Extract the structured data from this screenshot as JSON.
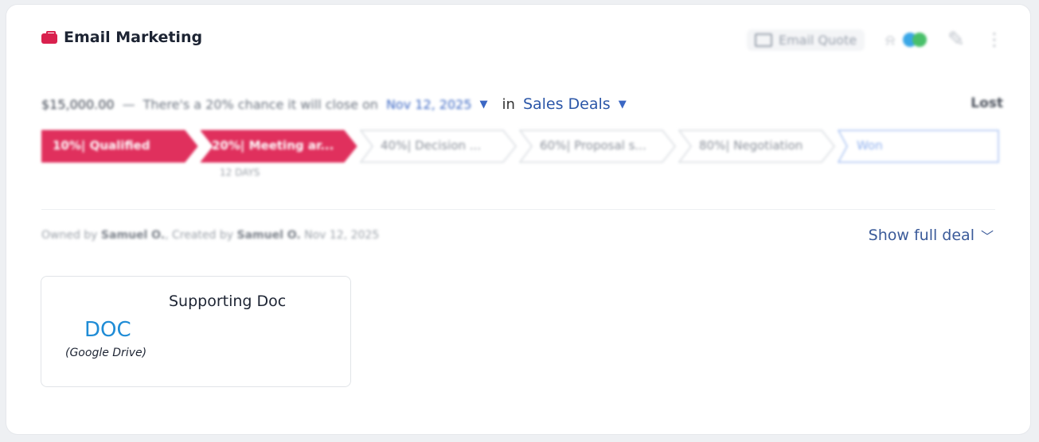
{
  "header": {
    "title": "Email Marketing",
    "email_quote_label": "Email Quote"
  },
  "summary": {
    "amount": "$15,000.00",
    "dash": "—",
    "chance_text": "There's a 20% chance it will close on",
    "close_date": "Nov 12, 2025",
    "in_label": "in",
    "pipeline": "Sales Deals",
    "lost_label": "Lost"
  },
  "stages": [
    {
      "label": "10%| Qualified",
      "active": true
    },
    {
      "label": "20%| Meeting ar...",
      "active": true
    },
    {
      "label": "40%| Decision ...",
      "active": false
    },
    {
      "label": "60%| Proposal s...",
      "active": false
    },
    {
      "label": "80%| Negotiation",
      "active": false
    },
    {
      "label": "Won",
      "active": false
    }
  ],
  "stage_sublabel": "12 DAYS",
  "meta": {
    "owned_by_label": "Owned by",
    "owner": "Samuel O.",
    "created_by_label": "Created by",
    "creator": "Samuel O.",
    "created_date": "Nov 12, 2025"
  },
  "show_full_deal": "Show full deal",
  "document": {
    "title": "Supporting Doc",
    "type": "DOC",
    "source": "(Google Drive)"
  },
  "colors": {
    "accent": "#d9214e",
    "link": "#3a5a99",
    "doc_blue": "#1f8cd6"
  }
}
